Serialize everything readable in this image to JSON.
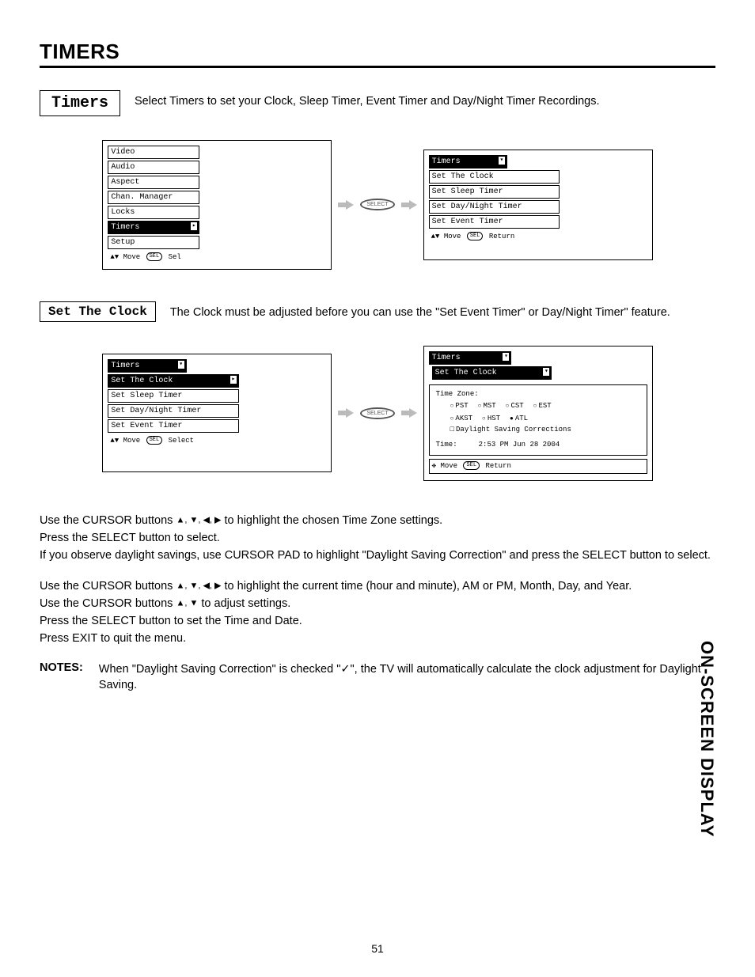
{
  "pageTitle": "TIMERS",
  "sideTab": "ON-SCREEN DISPLAY",
  "pageNumber": "51",
  "timersSection": {
    "label": "Timers",
    "intro": "Select Timers to set your Clock, Sleep Timer, Event Timer and Day/Night Timer Recordings."
  },
  "mainMenu": {
    "items": [
      "Video",
      "Audio",
      "Aspect",
      "Chan. Manager",
      "Locks",
      "Timers",
      "Setup"
    ],
    "footer": {
      "move": "Move",
      "sel": "SEL",
      "action": "Sel"
    }
  },
  "selectButton": "SELECT",
  "timersMenu": {
    "title": "Timers",
    "items": [
      "Set The Clock",
      "Set Sleep Timer",
      "Set Day/Night Timer",
      "Set Event Timer"
    ],
    "footer": {
      "move": "Move",
      "sel": "SEL",
      "action": "Return"
    }
  },
  "setClockSection": {
    "label": "Set The Clock",
    "intro": "The Clock must be adjusted before you can use the \"Set Event Timer\" or Day/Night Timer\" feature."
  },
  "timersSub1": {
    "title": "Timers",
    "selected": "Set The Clock",
    "items": [
      "Set Sleep Timer",
      "Set Day/Night Timer",
      "Set Event Timer"
    ],
    "footer": {
      "move": "Move",
      "sel": "SEL",
      "action": "Select"
    }
  },
  "clockScreen": {
    "title": "Timers",
    "selected": "Set The Clock",
    "tzLabel": "Time Zone:",
    "row1": [
      "PST",
      "MST",
      "CST",
      "EST"
    ],
    "row2": [
      "AKST",
      "HST",
      "ATL"
    ],
    "selectedTz": "ATL",
    "dst": "Daylight Saving Corrections",
    "timeLabel": "Time:",
    "timeValue": "2:53 PM Jun 28 2004",
    "footer": {
      "move": "Move",
      "sel": "SEL",
      "action": "Return"
    }
  },
  "instructions1": {
    "l1a": "Use the CURSOR buttons ",
    "l1b": " to highlight the chosen Time Zone settings.",
    "l2": "Press the SELECT button to select.",
    "l3": "If you observe daylight savings, use CURSOR PAD to highlight \"Daylight Saving Correction\" and press the SELECT button to select."
  },
  "instructions2": {
    "l1a": "Use the CURSOR buttons ",
    "l1b": " to highlight the current time (hour and minute), AM or PM, Month, Day, and Year.",
    "l2a": "Use the CURSOR buttons ",
    "l2b": " to adjust settings.",
    "l3": "Press the SELECT button to set the Time and Date.",
    "l4": "Press EXIT to quit the menu."
  },
  "notes": {
    "label": "NOTES:",
    "textA": "When \"Daylight Saving Correction\" is checked \"",
    "textB": "\", the TV will automatically calculate the clock adjustment for Daylight Saving."
  }
}
